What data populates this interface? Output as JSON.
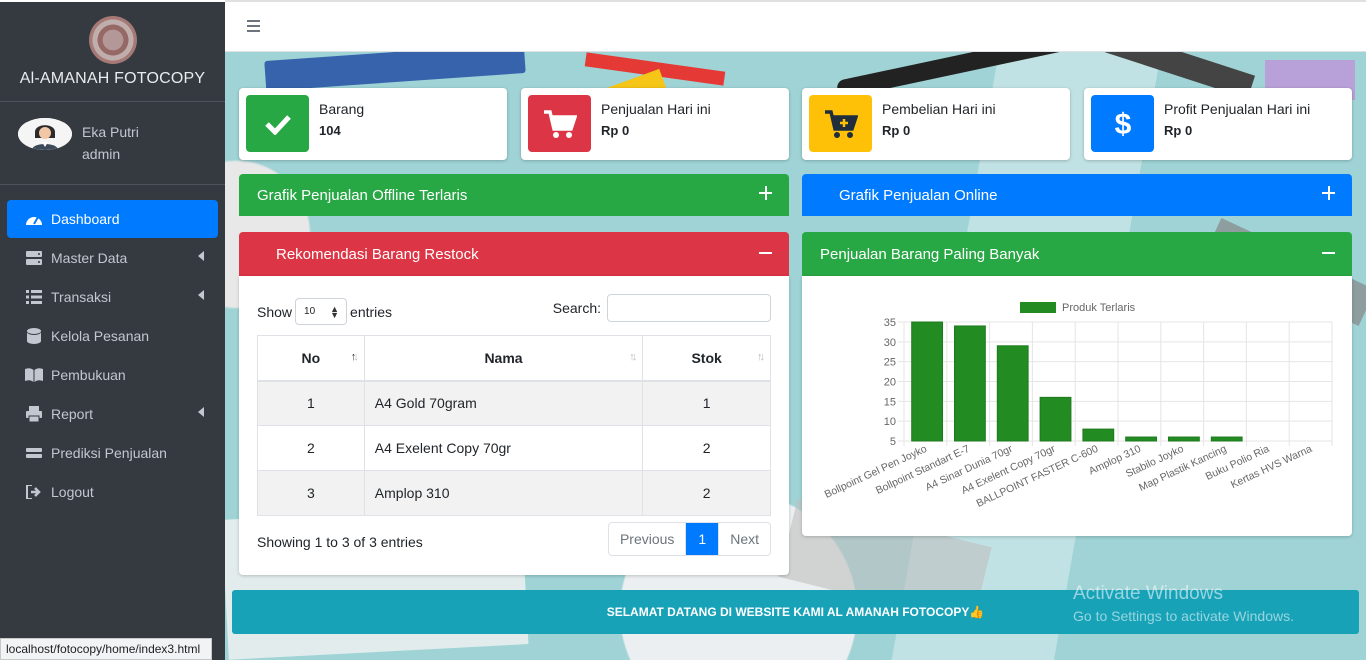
{
  "brand": {
    "name": "Al-AMANAH FOTOCOPY"
  },
  "user": {
    "name": "Eka Putri",
    "role": "admin"
  },
  "sidebar": {
    "items": [
      {
        "label": "Dashboard",
        "icon": "tachometer-icon",
        "active": true,
        "has_arrow": false
      },
      {
        "label": "Master Data",
        "icon": "server-icon",
        "active": false,
        "has_arrow": true
      },
      {
        "label": "Transaksi",
        "icon": "list-icon",
        "active": false,
        "has_arrow": true
      },
      {
        "label": "Kelola Pesanan",
        "icon": "database-icon",
        "active": false,
        "has_arrow": false
      },
      {
        "label": "Pembukuan",
        "icon": "book-icon",
        "active": false,
        "has_arrow": false
      },
      {
        "label": "Report",
        "icon": "printer-icon",
        "active": false,
        "has_arrow": true
      },
      {
        "label": "Prediksi Penjualan",
        "icon": "equals-icon",
        "active": false,
        "has_arrow": false
      },
      {
        "label": "Logout",
        "icon": "sign-out-icon",
        "active": false,
        "has_arrow": false
      }
    ]
  },
  "status_url": "localhost/fotocopy/home/index3.html",
  "info_boxes": [
    {
      "label": "Barang",
      "value": "104",
      "icon": "check-icon",
      "color": "#28a745"
    },
    {
      "label": "Penjualan Hari ini",
      "value": "Rp 0",
      "icon": "cart-icon",
      "color": "#dc3545"
    },
    {
      "label": "Pembelian Hari ini",
      "value": "Rp 0",
      "icon": "cart-plus-icon",
      "color": "#ffc107"
    },
    {
      "label": "Profit Penjualan Hari ini",
      "value": "Rp 0",
      "icon": "dollar-icon",
      "color": "#007bff"
    }
  ],
  "cards": {
    "offline_chart": {
      "title": "Grafik Penjualan Offline Terlaris",
      "color": "#28a745"
    },
    "online_chart": {
      "title": "Grafik Penjualan Online",
      "color": "#007bff"
    },
    "restock": {
      "title": "Rekomendasi Barang Restock",
      "color": "#dc3545"
    },
    "best_selling": {
      "title": "Penjualan Barang Paling Banyak",
      "color": "#28a745"
    }
  },
  "restock_table": {
    "show_label": "Show",
    "entries_label": "entries",
    "page_length": "10",
    "search_label": "Search:",
    "search_value": "",
    "columns": [
      "No",
      "Nama",
      "Stok"
    ],
    "rows": [
      {
        "no": "1",
        "nama": "A4 Gold 70gram",
        "stok": "1"
      },
      {
        "no": "2",
        "nama": "A4 Exelent Copy 70gr",
        "stok": "2"
      },
      {
        "no": "3",
        "nama": "Amplop 310",
        "stok": "2"
      }
    ],
    "info": "Showing 1 to 3 of 3 entries",
    "pager": {
      "previous": "Previous",
      "current": "1",
      "next": "Next"
    }
  },
  "chart_data": {
    "type": "bar",
    "legend": [
      "Produk Terlaris"
    ],
    "legend_position": "top",
    "categories": [
      "Bollpoint Gel Pen Joyko",
      "Bollpoint Standart E-7",
      "A4 Sinar Dunia 70gr",
      "A4 Exelent Copy 70gr",
      "BALLPOINT FASTER C-600",
      "Amplop 310",
      "Stabilo Joyko",
      "Map Plastik Kancing",
      "Buku Polio Ria",
      "Kertas HVS Warna"
    ],
    "series": [
      {
        "name": "Produk Terlaris",
        "values": [
          35,
          34,
          29,
          16,
          8,
          6,
          6,
          6,
          5,
          5
        ],
        "color": "#228B22"
      }
    ],
    "yticks": [
      5,
      10,
      15,
      20,
      25,
      30,
      35
    ],
    "ylim": [
      5,
      35
    ],
    "grid": true
  },
  "banner": {
    "text": "SELAMAT DATANG DI WEBSITE KAMI AL AMANAH FOTOCOPY👍"
  },
  "watermark": {
    "title": "Activate Windows",
    "subtitle": "Go to Settings to activate Windows."
  }
}
